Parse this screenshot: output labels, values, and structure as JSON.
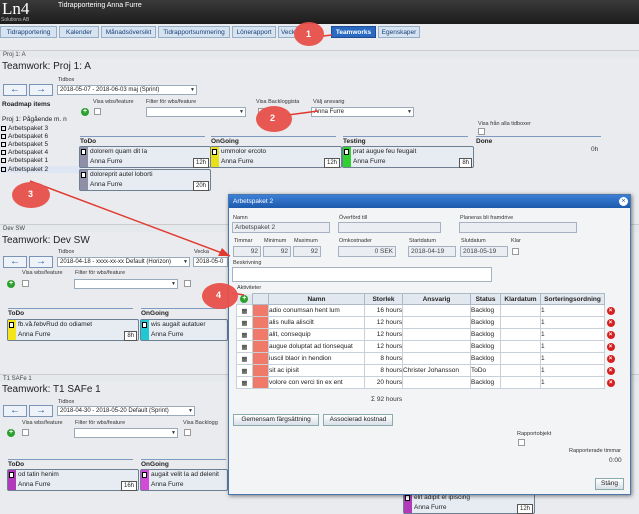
{
  "app": {
    "logo": "Ln4",
    "logo_sub": "Solutions AB",
    "title": "Tidrapportering Anna Furre"
  },
  "tabs": [
    {
      "label": "Tidrapportering"
    },
    {
      "label": "Kalender"
    },
    {
      "label": "Månadsöversikt"
    },
    {
      "label": "Tidrapportsummering"
    },
    {
      "label": "Lönerapport"
    },
    {
      "label": "Veck"
    },
    {
      "label": "Teamworks",
      "active": true
    },
    {
      "label": "Egenskaper"
    }
  ],
  "proj1": {
    "header": "Proj 1: A",
    "title": "Teamwork: Proj 1: A",
    "tidbox_label": "Tidbox",
    "tidbox_value": "2018-05-07 - 2018-06-03 maj (Sprint)",
    "visa_wbs": "Visa wbs/feature",
    "filter_wbs": "Filter för wbs/feature",
    "visa_backlog": "Visa Backloggista",
    "valj_ansvarig": "Välj ansvarig",
    "ansvarig_value": "Anna Furre",
    "visa_alla": "Visa från alla tidboxer",
    "roadmap_title": "Roadmap items",
    "roadmap_sub": "Proj 1: Pågående m. n",
    "roadmap": [
      "Arbetspaket 3",
      "Arbetspaket 6",
      "Arbetspaket 5",
      "Arbetspaket 4",
      "Arbetspaket 1",
      "Arbetspaket 2"
    ],
    "cols": [
      "ToDo",
      "OnGoing",
      "Testing",
      "Done"
    ],
    "done_hours": "0h",
    "cards": [
      {
        "t1": "dolorem quam dit la",
        "t2": "Anna Furre",
        "hrs": "12h"
      },
      {
        "t1": "doloreprit autel loborti",
        "t2": "Anna Furre",
        "hrs": "20h"
      },
      {
        "t1": "ummolor ercoto",
        "t2": "Anna Furre",
        "hrs": "12h"
      },
      {
        "t1": "prat augue feu feugait",
        "t2": "Anna Furre",
        "hrs": "8h"
      }
    ]
  },
  "dev": {
    "header": "Dev SW",
    "title": "Teamwork: Dev SW",
    "tidbox_label": "Tidbox",
    "tidbox_value": "2018-04-18 - xxxx-xx-xx Default (Horizon)",
    "vecka_label": "Vecka",
    "vecka_value": "2018-05-0",
    "visa_wbs": "Visa wbs/feature",
    "filter_wbs": "Filter för wbs/feature",
    "cols": [
      "ToDo",
      "OnGoing"
    ],
    "cards": [
      {
        "t1": "fb.vå.febvRud do odiamet",
        "t2": "Anna Furre",
        "hrs": "8h"
      },
      {
        "t1": "wis augait autatuer",
        "t2": "Anna Furre",
        "hrs": ""
      }
    ]
  },
  "safe": {
    "header": "T1 SAFe 1",
    "title": "Teamwork: T1 SAFe 1",
    "tidbox_label": "Tidbox",
    "tidbox_value": "2018-04-30 - 2018-05-20 Default (Sprint)",
    "visa_wbs": "Visa wbs/feature",
    "filter_wbs": "Filter för wbs/feature",
    "visa_backlog": "Visa Backlogg",
    "cols": [
      "ToDo",
      "OnGoing"
    ],
    "cards": [
      {
        "t1": "od tatin henim",
        "t2": "Anna Furre",
        "hrs": "16h"
      },
      {
        "t1": "augait velit la ad delenit",
        "t2": "Anna Furre",
        "hrs": ""
      },
      {
        "t1": "elit adipit el ipiscing",
        "t2": "Anna Furre",
        "hrs": "12h"
      }
    ]
  },
  "modal": {
    "title": "Arbetspaket 2",
    "namn_label": "Namn",
    "namn_value": "Arbetspaket 2",
    "overford_label": "Överförd till",
    "planeras_label": "Planeras bli framdrive",
    "timmar_label": "Timmar",
    "timmar_value": "92",
    "minimum_label": "Minimum",
    "minimum_value": "92",
    "maximum_label": "Maximum",
    "maximum_value": "92",
    "omkostnader_label": "Omkostnader",
    "omkostnader_value": "0 SEK",
    "startdatum_label": "Startdatum",
    "startdatum_value": "2018-04-19",
    "slutdatum_label": "Slutdatum",
    "slutdatum_value": "2018-05-19",
    "klar_label": "Klar",
    "beskrivning_label": "Beskrivning",
    "aktiviteter_label": "Aktiviteter",
    "table_headers": [
      "Namn",
      "Storlek",
      "Ansvarig",
      "Status",
      "Klardatum",
      "Sorteringsordning"
    ],
    "rows": [
      {
        "namn": "adio conumsan hent lum",
        "storlek": "16 hours",
        "ansvarig": "",
        "status": "Backlog",
        "klardatum": "",
        "sort": "1"
      },
      {
        "namn": "alis nulla aliscilt",
        "storlek": "12 hours",
        "ansvarig": "",
        "status": "Backlog",
        "klardatum": "",
        "sort": "1"
      },
      {
        "namn": "alit, consequip",
        "storlek": "12 hours",
        "ansvarig": "",
        "status": "Backlog",
        "klardatum": "",
        "sort": "1"
      },
      {
        "namn": "augue doluptat ad tionsequat",
        "storlek": "12 hours",
        "ansvarig": "",
        "status": "Backlog",
        "klardatum": "",
        "sort": "1"
      },
      {
        "namn": "iuscil blaor in hendion",
        "storlek": "8 hours",
        "ansvarig": "",
        "status": "Backlog",
        "klardatum": "",
        "sort": "1"
      },
      {
        "namn": "sit ac ipisit",
        "storlek": "8 hours",
        "ansvarig": "Christer Johansson",
        "status": "ToDo",
        "klardatum": "",
        "sort": "1"
      },
      {
        "namn": "volore con verci tin ex ent",
        "storlek": "20 hours",
        "ansvarig": "",
        "status": "Backlog",
        "klardatum": "",
        "sort": "1"
      }
    ],
    "total": "Σ 92 hours",
    "btn_gemensam": "Gemensam färgsättning",
    "btn_associerad": "Associerad kostnad",
    "rapportobjekt_label": "Rapportobjekt",
    "rapporterade_label": "Rapporterade timmar",
    "rapporterade_value": "0:00",
    "btn_stang": "Stäng"
  },
  "badges": [
    "1",
    "2",
    "3",
    "4"
  ],
  "colors": {
    "accent": "#2a6ac2",
    "badge": "#e8504a",
    "todo_bar": "#8f8fa8",
    "ongoing_bar": "#e6df1a",
    "testing_bar": "#2fd02f",
    "dev_todo": "#f2e61a",
    "dev_ongoing": "#22c7d4",
    "safe_todo": "#b03ab8",
    "safe_ongoing": "#d14ad8"
  }
}
